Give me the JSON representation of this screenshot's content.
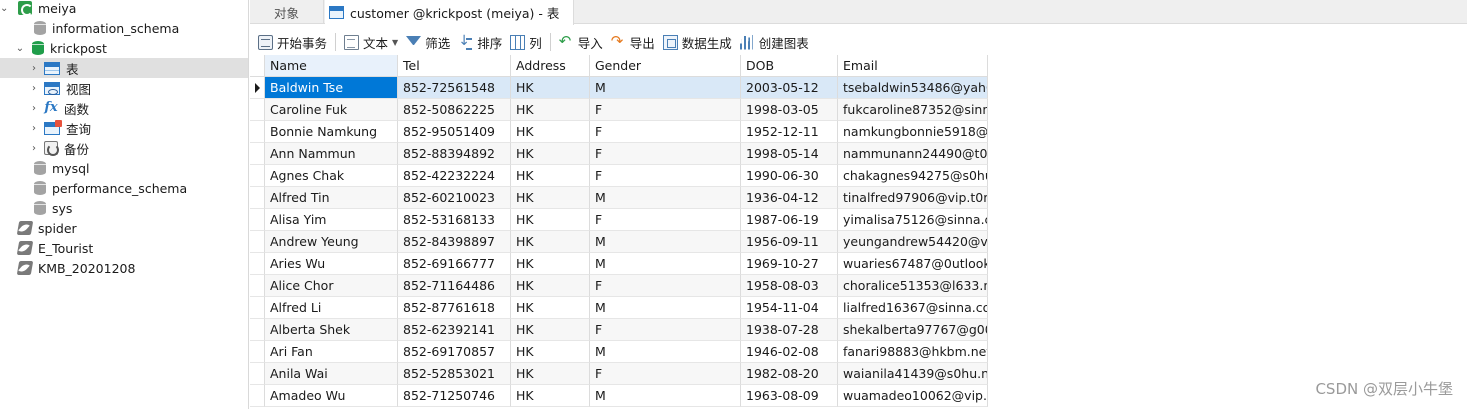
{
  "sidebar": {
    "items": [
      {
        "label": "meiya",
        "icon": "connection-icon",
        "toggle": "⌄"
      },
      {
        "label": "information_schema",
        "icon": "database-icon"
      },
      {
        "label": "krickpost",
        "icon": "database-open-icon",
        "toggle": "⌄"
      },
      {
        "label": "表",
        "icon": "table-icon",
        "toggle": "›"
      },
      {
        "label": "视图",
        "icon": "view-icon",
        "toggle": "›"
      },
      {
        "label": "函数",
        "icon": "function-icon",
        "toggle": "›"
      },
      {
        "label": "查询",
        "icon": "query-icon",
        "toggle": "›"
      },
      {
        "label": "备份",
        "icon": "backup-icon",
        "toggle": "›"
      },
      {
        "label": "mysql",
        "icon": "database-icon"
      },
      {
        "label": "performance_schema",
        "icon": "database-icon"
      },
      {
        "label": "sys",
        "icon": "database-icon"
      },
      {
        "label": "spider",
        "icon": "connection-icon"
      },
      {
        "label": "E_Tourist",
        "icon": "connection-icon"
      },
      {
        "label": "KMB_20201208",
        "icon": "connection-icon"
      }
    ]
  },
  "tabs": {
    "objects": "对象",
    "active": "customer @krickpost (meiya) - 表"
  },
  "toolbar": {
    "begin_transaction": "开始事务",
    "text": "文本",
    "filter": "筛选",
    "sort": "排序",
    "columns": "列",
    "import": "导入",
    "export": "导出",
    "data_generation": "数据生成",
    "create_chart": "创建图表"
  },
  "grid": {
    "columns": [
      "Name",
      "Tel",
      "Address",
      "Gender",
      "DOB",
      "Email"
    ],
    "rows": [
      [
        "Baldwin Tse",
        "852-72561548",
        "HK",
        "M",
        "2003-05-12",
        "tsebaldwin53486@yah0("
      ],
      [
        "Caroline Fuk",
        "852-50862225",
        "HK",
        "F",
        "1998-03-05",
        "fukcaroline87352@sinna"
      ],
      [
        "Bonnie Namkung",
        "852-95051409",
        "HK",
        "F",
        "1952-12-11",
        "namkungbonnie5918@s"
      ],
      [
        "Ann Nammun",
        "852-88394892",
        "HK",
        "F",
        "1998-05-14",
        "nammunann24490@t0m"
      ],
      [
        "Agnes Chak",
        "852-42232224",
        "HK",
        "F",
        "1990-06-30",
        "chakagnes94275@s0hu."
      ],
      [
        "Alfred Tin",
        "852-60210023",
        "HK",
        "M",
        "1936-04-12",
        "tinalfred97906@vip.t0m."
      ],
      [
        "Alisa Yim",
        "852-53168133",
        "HK",
        "F",
        "1987-06-19",
        "yimalisa75126@sinna.co"
      ],
      [
        "Andrew Yeung",
        "852-84398897",
        "HK",
        "M",
        "1956-09-11",
        "yeungandrew54420@vip"
      ],
      [
        "Aries Wu",
        "852-69166777",
        "HK",
        "M",
        "1969-10-27",
        "wuaries67487@0utlook.("
      ],
      [
        "Alice Chor",
        "852-71164486",
        "HK",
        "F",
        "1958-08-03",
        "choralice51353@l633.ne"
      ],
      [
        "Alfred Li",
        "852-87761618",
        "HK",
        "M",
        "1954-11-04",
        "lialfred16367@sinna.con"
      ],
      [
        "Alberta Shek",
        "852-62392141",
        "HK",
        "F",
        "1938-07-28",
        "shekalberta97767@g00("
      ],
      [
        "Ari Fan",
        "852-69170857",
        "HK",
        "M",
        "1946-02-08",
        "fanari98883@hkbm.net"
      ],
      [
        "Anila Wai",
        "852-52853021",
        "HK",
        "F",
        "1982-08-20",
        "waianila41439@s0hu.net"
      ],
      [
        "Amadeo Wu",
        "852-71250746",
        "HK",
        "M",
        "1963-08-09",
        "wuamadeo10062@vip.si"
      ]
    ]
  },
  "watermark": "CSDN @双层小牛堡"
}
